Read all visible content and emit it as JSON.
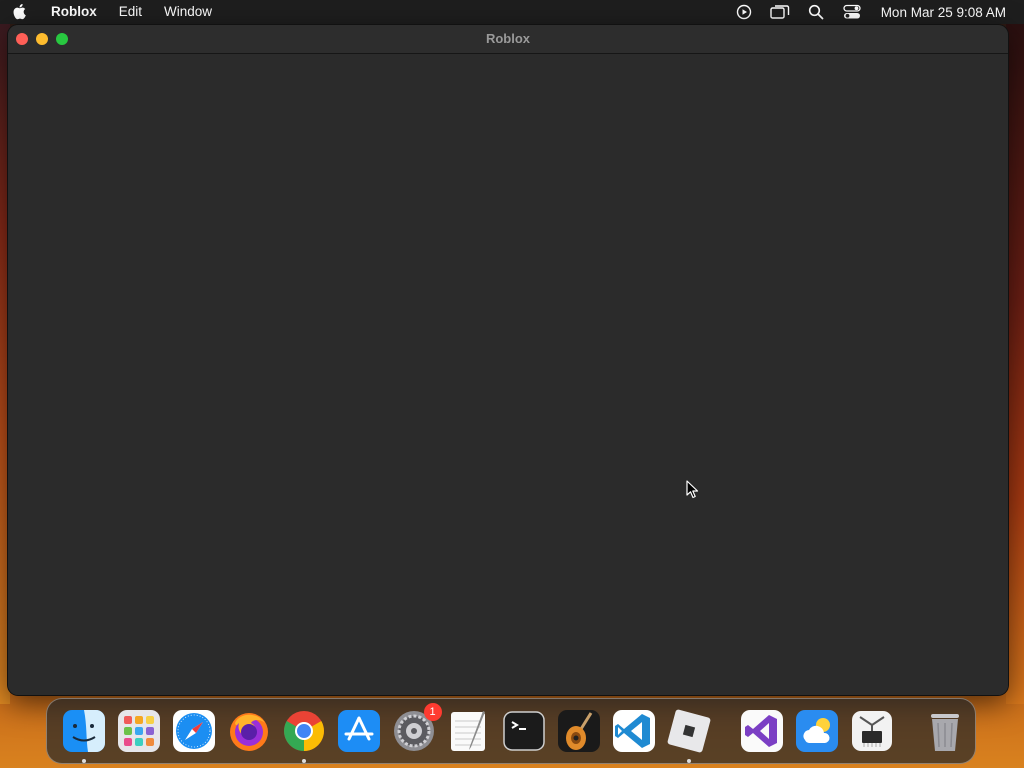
{
  "menubar": {
    "app_name": "Roblox",
    "items": [
      "Edit",
      "Window"
    ],
    "clock": "Mon Mar 25  9:08 AM",
    "status_icons": [
      "screen-record-icon",
      "screen-mirroring-icon",
      "spotlight-search-icon",
      "control-center-icon"
    ]
  },
  "window": {
    "title": "Roblox"
  },
  "dock": {
    "apps": [
      {
        "name": "finder-icon",
        "running": true
      },
      {
        "name": "launchpad-icon",
        "running": false
      },
      {
        "name": "safari-icon",
        "running": false
      },
      {
        "name": "firefox-icon",
        "running": false
      },
      {
        "name": "chrome-icon",
        "running": true
      },
      {
        "name": "app-store-icon",
        "running": false
      },
      {
        "name": "system-settings-icon",
        "running": false,
        "badge": "1"
      },
      {
        "name": "textedit-icon",
        "running": false
      },
      {
        "name": "terminal-icon",
        "running": false
      },
      {
        "name": "garageband-icon",
        "running": false
      },
      {
        "name": "vscode-icon",
        "running": false
      },
      {
        "name": "roblox-icon",
        "running": true
      }
    ],
    "recent": [
      {
        "name": "visual-studio-icon"
      },
      {
        "name": "weather-icon"
      },
      {
        "name": "system-information-icon"
      }
    ],
    "trash": {
      "name": "trash-icon"
    }
  }
}
